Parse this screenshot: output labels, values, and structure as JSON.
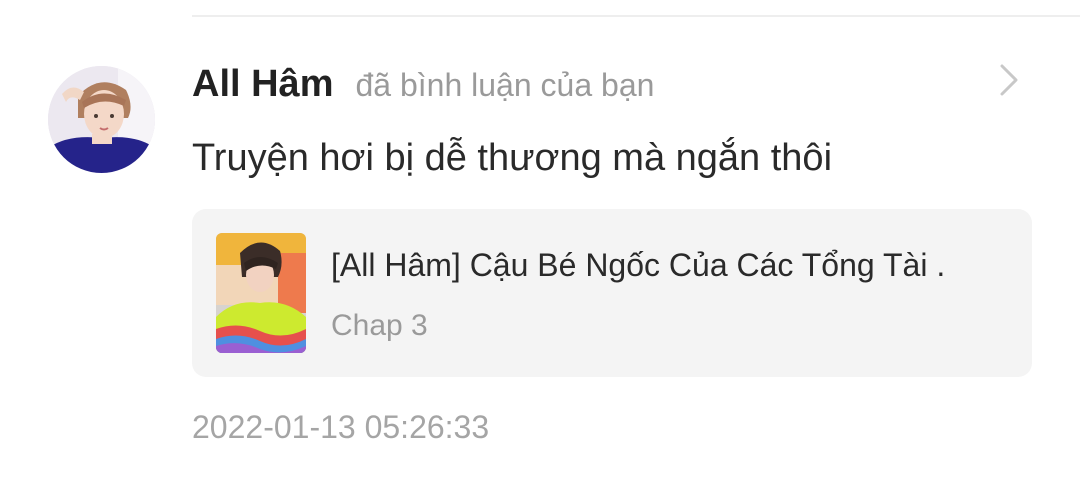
{
  "notification": {
    "user_name": "All Hâm",
    "action_text": "đã bình luận của bạn",
    "comment_text": "Truyện hơi bị dễ thương mà ngắn thôi",
    "timestamp": "2022-01-13 05:26:33",
    "icons": {
      "chevron": "chevron-right-icon"
    }
  },
  "story": {
    "title": "[All Hâm] Cậu Bé Ngốc Của Các Tổng Tài .",
    "chapter": "Chap 3"
  },
  "colors": {
    "background": "#ffffff",
    "card_background": "#f4f4f4",
    "primary_text": "#222222",
    "secondary_text": "#9a9a9a",
    "divider": "#eeeeee"
  }
}
